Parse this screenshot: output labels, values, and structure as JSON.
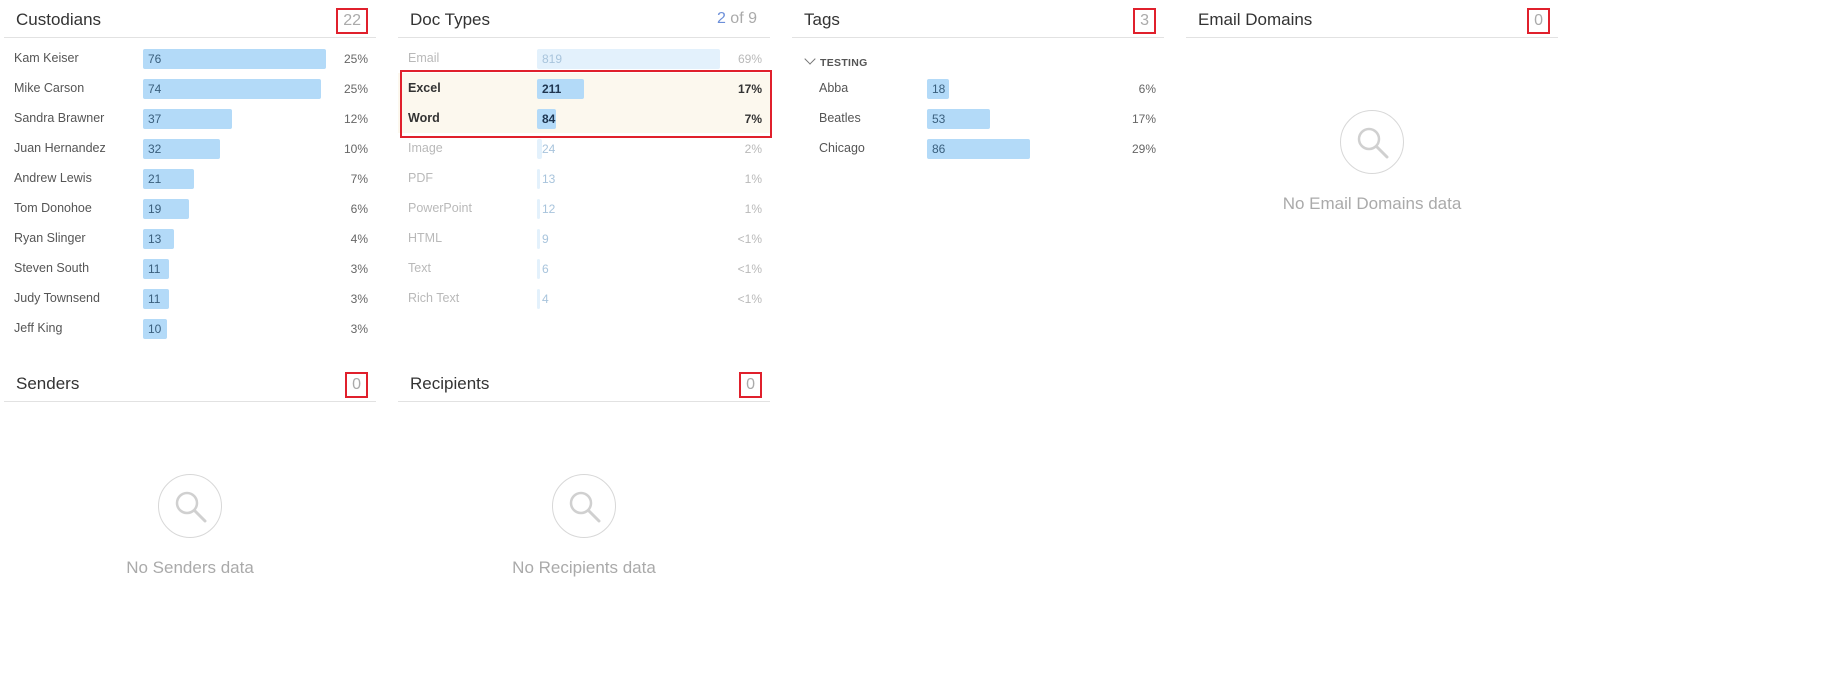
{
  "custodians": {
    "title": "Custodians",
    "count": "22",
    "rows": [
      {
        "name": "Kam Keiser",
        "value": 76,
        "pct": "25%"
      },
      {
        "name": "Mike Carson",
        "value": 74,
        "pct": "25%"
      },
      {
        "name": "Sandra Brawner",
        "value": 37,
        "pct": "12%"
      },
      {
        "name": "Juan Hernandez",
        "value": 32,
        "pct": "10%"
      },
      {
        "name": "Andrew Lewis",
        "value": 21,
        "pct": "7%"
      },
      {
        "name": "Tom Donohoe",
        "value": 19,
        "pct": "6%"
      },
      {
        "name": "Ryan Slinger",
        "value": 13,
        "pct": "4%"
      },
      {
        "name": "Steven South",
        "value": 11,
        "pct": "3%"
      },
      {
        "name": "Judy Townsend",
        "value": 11,
        "pct": "3%"
      },
      {
        "name": "Jeff King",
        "value": 10,
        "pct": "3%"
      }
    ]
  },
  "doc_types": {
    "title": "Doc Types",
    "selected_count": "2",
    "of_label": "of",
    "total": "9",
    "rows": [
      {
        "name": "Email",
        "value": 819,
        "pct": "69%",
        "state": "faded"
      },
      {
        "name": "Excel",
        "value": 211,
        "pct": "17%",
        "state": "selected"
      },
      {
        "name": "Word",
        "value": 84,
        "pct": "7%",
        "state": "selected"
      },
      {
        "name": "Image",
        "value": 24,
        "pct": "2%",
        "state": "faded"
      },
      {
        "name": "PDF",
        "value": 13,
        "pct": "1%",
        "state": "faded"
      },
      {
        "name": "PowerPoint",
        "value": 12,
        "pct": "1%",
        "state": "faded"
      },
      {
        "name": "HTML",
        "value": 9,
        "pct": "<1%",
        "state": "faded"
      },
      {
        "name": "Text",
        "value": 6,
        "pct": "<1%",
        "state": "faded"
      },
      {
        "name": "Rich Text",
        "value": 4,
        "pct": "<1%",
        "state": "faded"
      }
    ]
  },
  "tags": {
    "title": "Tags",
    "count": "3",
    "group": "TESTING",
    "rows": [
      {
        "name": "Abba",
        "value": 18,
        "pct": "6%"
      },
      {
        "name": "Beatles",
        "value": 53,
        "pct": "17%"
      },
      {
        "name": "Chicago",
        "value": 86,
        "pct": "29%"
      }
    ]
  },
  "email_domains": {
    "title": "Email Domains",
    "count": "0",
    "empty_text": "No Email Domains data"
  },
  "senders": {
    "title": "Senders",
    "count": "0",
    "empty_text": "No Senders data"
  },
  "recipients": {
    "title": "Recipients",
    "count": "0",
    "empty_text": "No Recipients data"
  },
  "colors": {
    "bar": "#b3daf8",
    "bar_faded": "#e3f1fc",
    "highlight_border": "#e0202c",
    "selected_bg": "#fcf8ee"
  },
  "icons": {
    "empty": "magnifier-icon",
    "group_toggle": "chevron-down-icon"
  }
}
